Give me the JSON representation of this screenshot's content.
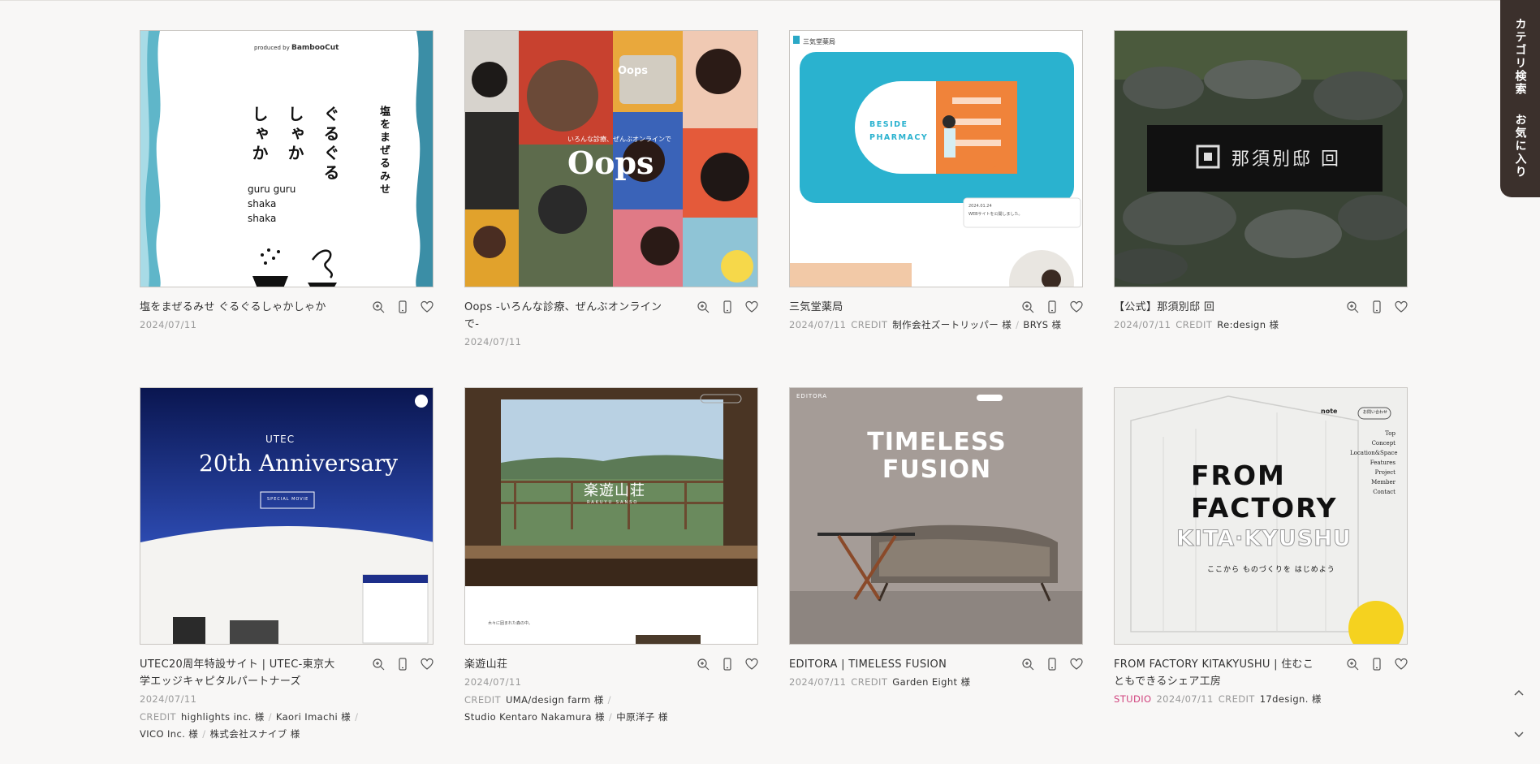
{
  "side_tab": {
    "category_search": "カテゴリ検索",
    "favorites": "お気に入り"
  },
  "icons": {
    "zoom": "zoom-in-icon",
    "mobile": "smartphone-icon",
    "favorite": "heart-icon",
    "up": "chevron-up-icon",
    "down": "chevron-down-icon"
  },
  "colors": {
    "studio_badge": "#d1447f",
    "side_tab_bg": "#3b302c"
  },
  "cards": [
    {
      "title": "塩をまぜるみせ ぐるぐるしゃかしゃか",
      "date": "2024/07/11",
      "credit_label": "",
      "credits": [],
      "thumb": {
        "producer": "produced by",
        "brand": "BambooCut",
        "vtitle_1": "塩をまぜるみせ",
        "vtitle_2": "ぐるぐる",
        "vtitle_3": "しゃか",
        "vtitle_4": "しゃか",
        "roman_1": "guru guru",
        "roman_2": "shaka",
        "roman_3": "shaka"
      }
    },
    {
      "title": "Oops -いろんな診療、ぜんぶオンラインで-",
      "date": "2024/07/11",
      "credit_label": "",
      "credits": [],
      "thumb": {
        "logo": "Oops",
        "pill": "Oops",
        "tagline": "いろんな診療、ぜんぶオンラインで"
      }
    },
    {
      "title": "三気堂薬局",
      "date": "2024/07/11",
      "credit_label": "CREDIT",
      "credits": [
        "制作会社ズートリッパー 様",
        "BRYS 様"
      ],
      "thumb": {
        "site_name": "三気堂薬局",
        "hero_1": "BESIDE",
        "hero_2": "PHARMACY",
        "news_date": "2024.01.24",
        "news_text": "WEBサイトを公開しました。"
      }
    },
    {
      "title": "【公式】那須別邸 回",
      "date": "2024/07/11",
      "credit_label": "CREDIT",
      "credits": [
        "Re:design 様"
      ],
      "thumb": {
        "sign": "那須別邸 回"
      }
    },
    {
      "title": "UTEC20周年特設サイト | UTEC-東京大学エッジキャピタルパートナーズ",
      "date": "2024/07/11",
      "credit_label": "CREDIT",
      "credits": [
        "highlights inc. 様",
        "Kaori Imachi 様",
        "VICO Inc. 様",
        "株式会社スナイブ 様"
      ],
      "thumb": {
        "brand": "UTEC",
        "headline": "20th Anniversary",
        "button": "SPECIAL MOVIE"
      }
    },
    {
      "title": "楽遊山荘",
      "date": "2024/07/11",
      "credit_label": "CREDIT",
      "credits": [
        "UMA/design farm 様",
        "Studio Kentaro Nakamura 様",
        "中原洋子 様"
      ],
      "thumb": {
        "logo": "楽遊山荘",
        "roman": "RAKUYU SANSO",
        "caption": "木々に囲まれた森の中。"
      }
    },
    {
      "title": "EDITORA | TIMELESS FUSION",
      "date": "2024/07/11",
      "credit_label": "CREDIT",
      "credits": [
        "Garden Eight 様"
      ],
      "thumb": {
        "brand": "EDITORA",
        "headline_1": "TIMELESS",
        "headline_2": "FUSION"
      }
    },
    {
      "title": "FROM FACTORY KITAKYUSHU | 住むこともできるシェア工房",
      "date": "2024/07/11",
      "studio": "STUDIO",
      "credit_label": "CREDIT",
      "credits": [
        "17design. 様"
      ],
      "thumb": {
        "line_1": "FROM",
        "line_2": "FACTORY",
        "line_3": "KITA·KYUSHU",
        "sub": "ここから ものづくりを はじめよう",
        "note": "note",
        "menu": [
          "Top",
          "Concept",
          "Location&Space",
          "Features",
          "Project Member",
          "Contact"
        ],
        "badge": "お問い合わせ"
      }
    }
  ]
}
